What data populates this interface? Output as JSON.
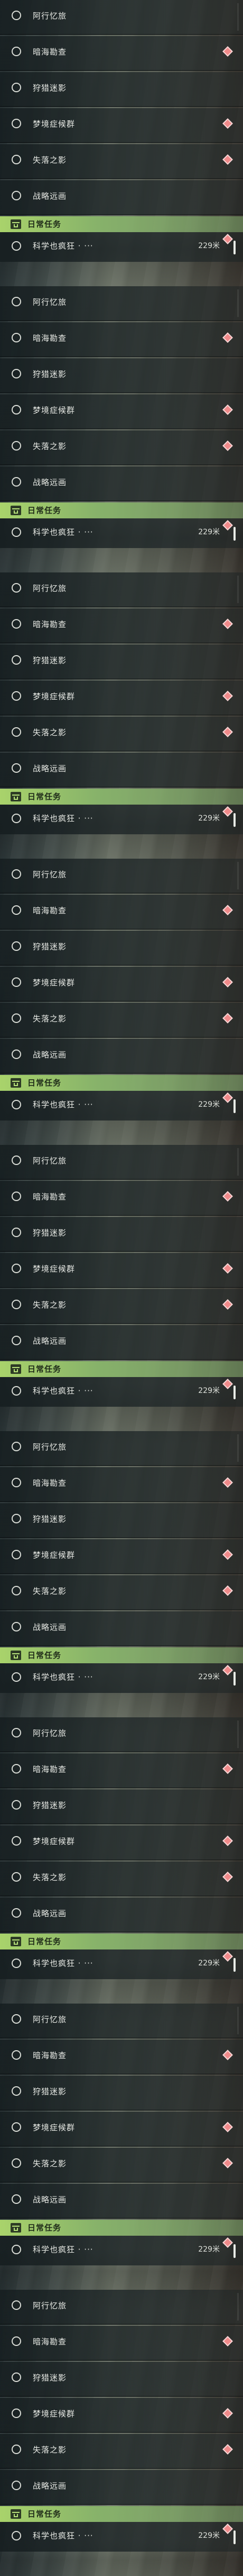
{
  "quests": [
    "阿行忆旅",
    "暗海勘查",
    "狩猎迷影",
    "梦境症候群",
    "失落之影",
    "战略远画"
  ],
  "daily": {
    "title": "日常任务",
    "quest_label": "科学也疯狂 ·  ···",
    "distance": "229米"
  },
  "repeat_count": 9,
  "colors": {
    "accent_green": "#a9d36b",
    "marker_pink": "#f08a8a",
    "row_dark": "#161e20"
  },
  "icons": {
    "quest_status": "circle-radio-icon",
    "quest_marker": "diamond-marker-icon",
    "daily_header": "calendar-icon"
  }
}
